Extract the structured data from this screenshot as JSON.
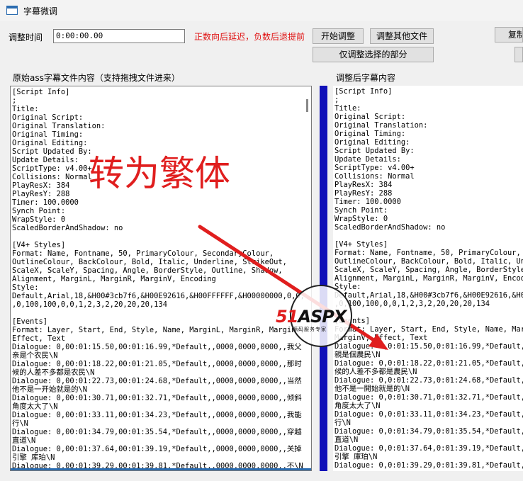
{
  "window": {
    "title": "字幕微调"
  },
  "toolbar": {
    "time_label": "调整时间",
    "time_value": "0:00:00.00",
    "hint": "正数向后延迟，负数后退提前",
    "start_button": "开始调整",
    "other_files_button": "调整其他文件",
    "copy_button": "复制",
    "selected_only_button": "仅调整选择的部分"
  },
  "left": {
    "label": "原始ass字幕文件内容（支持拖拽文件进来）",
    "content": "[Script Info]\n;\nTitle:\nOriginal Script:\nOriginal Translation:\nOriginal Timing:\nOriginal Editing:\nScript Updated By:\nUpdate Details:\nScriptType: v4.00+\nCollisions: Normal\nPlayResX: 384\nPlayResY: 288\nTimer: 100.0000\nSynch Point:\nWrapStyle: 0\nScaledBorderAndShadow: no\n\n[V4+ Styles]\nFormat: Name, Fontname, 50, PrimaryColour, SecondaryColour,\nOutlineColour, BackColour, Bold, Italic, Underline, StrikeOut,\nScaleX, ScaleY, Spacing, Angle, BorderStyle, Outline, Shadow,\nAlignment, MarginL, MarginR, MarginV, Encoding\nStyle:\nDefault,Arial,18,&H00#3cb7f6,&H00E92616,&H00FFFFFF,&H00000000,0,0,0\n,0,100,100,0,0,1,2,3,2,20,20,20,134\n\n[Events]\nFormat: Layer, Start, End, Style, Name, MarginL, MarginR, MarginV,\nEffect, Text\nDialogue: 0,00:01:15.50,00:01:16.99,*Default,,0000,0000,0000,,我父\n亲是个农民\\N\nDialogue: 0,00:01:18.22,00:01:21.05,*Default,,0000,0000,0000,,那时\n候的人差不多都是农民\\N\nDialogue: 0,00:01:22.73,00:01:24.68,*Default,,0000,0000,0000,,当然\n他不是一开始就是的\\N\nDialogue: 0,00:01:30.71,00:01:32.71,*Default,,0000,0000,0000,,倾斜\n角度太大了\\N\nDialogue: 0,00:01:33.11,00:01:34.23,*Default,,0000,0000,0000,,我能\n行\\N\nDialogue: 0,00:01:34.79,00:01:35.54,*Default,,0000,0000,0000,,穿越\n直道\\N\nDialogue: 0,00:01:37.64,00:01:39.19,*Default,,0000,0000,0000,,关掉\n引擎 库珀\\N\nDialogue: 0,00:01:39.29,00:01:39.81,*Default,,0000,0000,0000,,不\\N"
  },
  "right": {
    "label": "调整后字幕内容",
    "content": "[Script Info]\n;\nTitle:\nOriginal Script:\nOriginal Translation:\nOriginal Timing:\nOriginal Editing:\nScript Updated By:\nUpdate Details:\nScriptType: v4.00+\nCollisions: Normal\nPlayResX: 384\nPlayResY: 288\nTimer: 100.0000\nSynch Point:\nWrapStyle: 0\nScaledBorderAndShadow: no\n\n[V4+ Styles]\nFormat: Name, Fontname, 50, PrimaryColour, S\nOutlineColour, BackColour, Bold, Italic, Und\nScaleX, ScaleY, Spacing, Angle, BorderStyle,\nAlignment, MarginL, MarginR, MarginV, Encodi\nStyle:\nDefault,Arial,18,&H00#3cb7f6,&H00E92616,&H00\n,0,100,100,0,0,1,2,3,2,20,20,20,134\n\n[Events]\nFormat: Layer, Start, End, Style, Name, Marg\nMarginV, Effect, Text\nDialogue: 0,0:01:15.50,0:01:16.99,*Default,\n親是個農民\\N\nDialogue: 0,0:01:18.22,0:01:21.05,*Default,\n候的人差不多都是農民\\N\nDialogue: 0,0:01:22.73,0:01:24.68,*Default,\n他不是一開始就是的\\N\nDialogue: 0,0:01:30.71,0:01:32.71,*Default,\n角度太大了\\N\nDialogue: 0,0:01:33.11,0:01:34.23,*Default,\n行\\N\nDialogue: 0,0:01:34.79,0:01:35.54,*Default,\n直道\\N\nDialogue: 0,0:01:37.64,0:01:39.19,*Default,\n引擎 庫珀\\N\nDialogue: 0,0:01:39.29,0:01:39.81,*Default,"
  },
  "annotation": {
    "text": "转为繁体"
  },
  "watermark": {
    "brand_red": "51",
    "brand_dark": "ASPX",
    "sub": "源码服务专家"
  },
  "colors": {
    "hint_red": "#e01010",
    "divider_blue": "#1010b8",
    "annotation_red": "#e01e1e"
  }
}
